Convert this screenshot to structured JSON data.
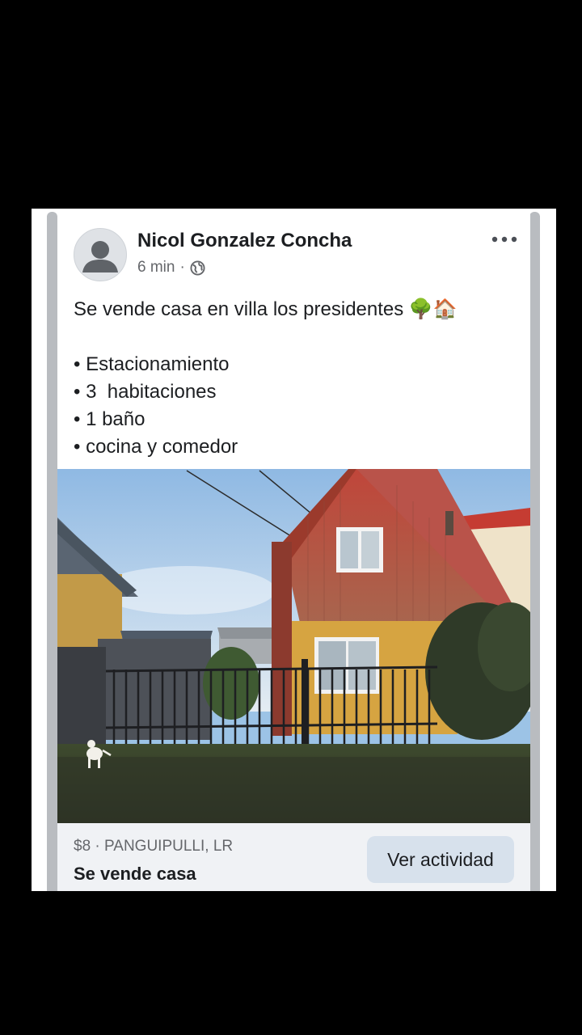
{
  "post": {
    "author": "Nicol Gonzalez Concha",
    "time": "6 min",
    "separator": "·",
    "privacy_icon": "globe-icon",
    "more_icon": "more-options-icon",
    "text_lines": [
      "Se vende casa en villa los presidentes 🌳🏠",
      "",
      "• Estacionamiento",
      "• 3  habitaciones",
      "• 1 baño",
      "• cocina y comedor"
    ]
  },
  "listing": {
    "meta": "$8 · PANGUIPULLI, LR",
    "title": "Se vende casa",
    "button_label": "Ver actividad"
  },
  "colors": {
    "background": "#000000",
    "card": "#ffffff",
    "listing_bar": "#f0f2f5",
    "button": "#d7e1ec",
    "secondary_text": "#65676b"
  }
}
